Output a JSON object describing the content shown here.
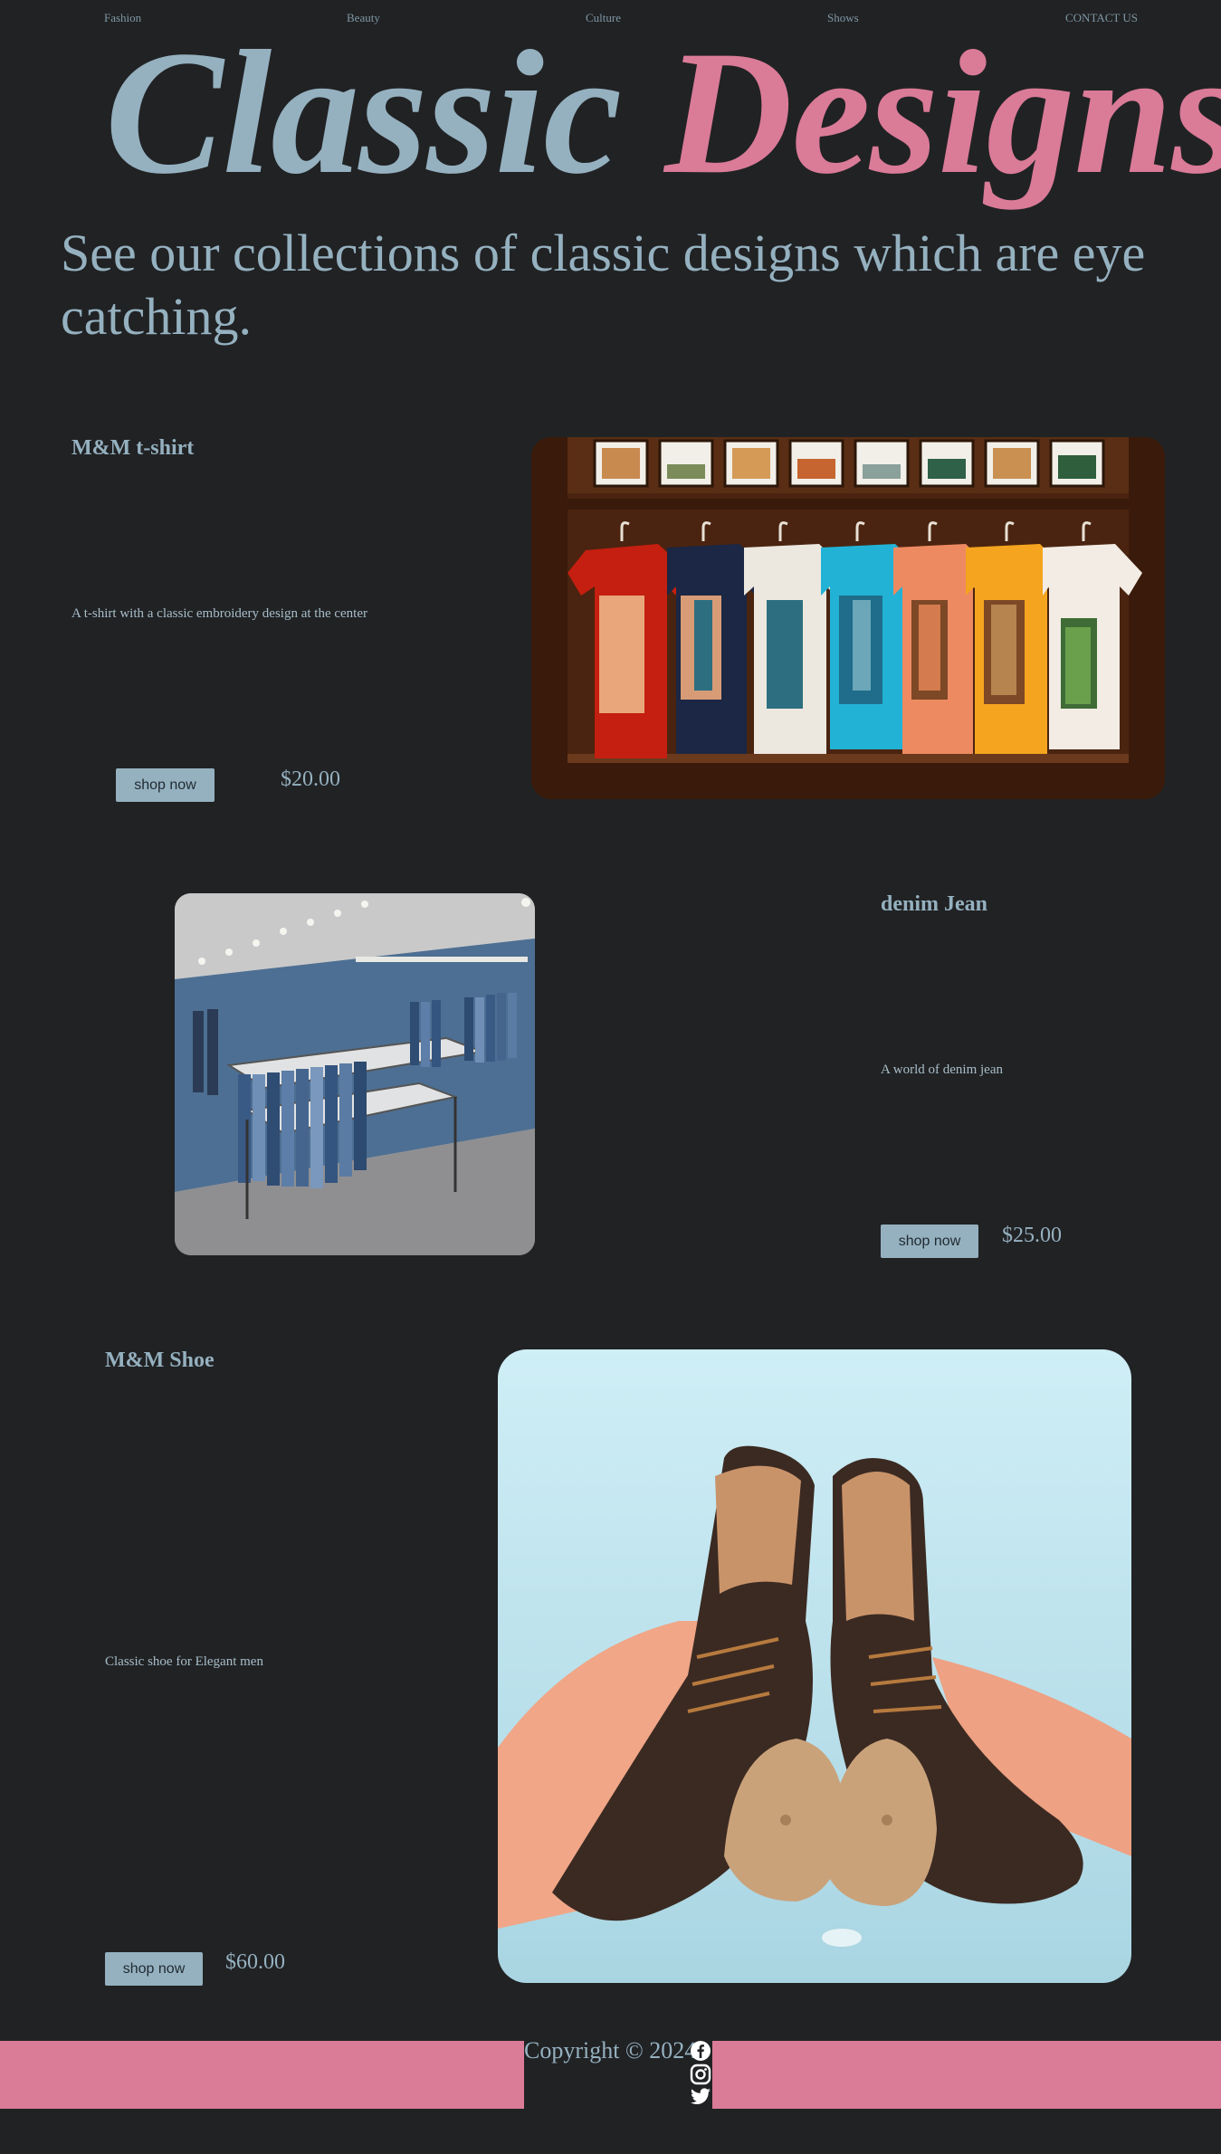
{
  "nav": {
    "items": [
      {
        "label": "Fashion"
      },
      {
        "label": "Beauty"
      },
      {
        "label": "Culture"
      },
      {
        "label": "Shows"
      },
      {
        "label": "CONTACT US"
      }
    ]
  },
  "hero": {
    "title_word1": "Classic",
    "title_word2": "Designs",
    "subtitle": "See our collections of classic designs which are eye catching."
  },
  "products": [
    {
      "title": "M&M t-shirt",
      "description": "A t-shirt with a classic embroidery design at the center",
      "button": "shop now",
      "price": "$20.00"
    },
    {
      "title": "denim Jean",
      "description": "A world of denim jean",
      "button": "shop now",
      "price": "$25.00"
    },
    {
      "title": "M&M Shoe",
      "description": "Classic shoe for Elegant men",
      "button": "shop now",
      "price": "$60.00"
    }
  ],
  "footer": {
    "copyright": "Copyright © 2024",
    "social_icons": [
      "facebook-icon",
      "instagram-icon",
      "twitter-icon"
    ]
  },
  "colors": {
    "background": "#212224",
    "accent_blue": "#95b1c0",
    "accent_pink": "#da7b98"
  }
}
